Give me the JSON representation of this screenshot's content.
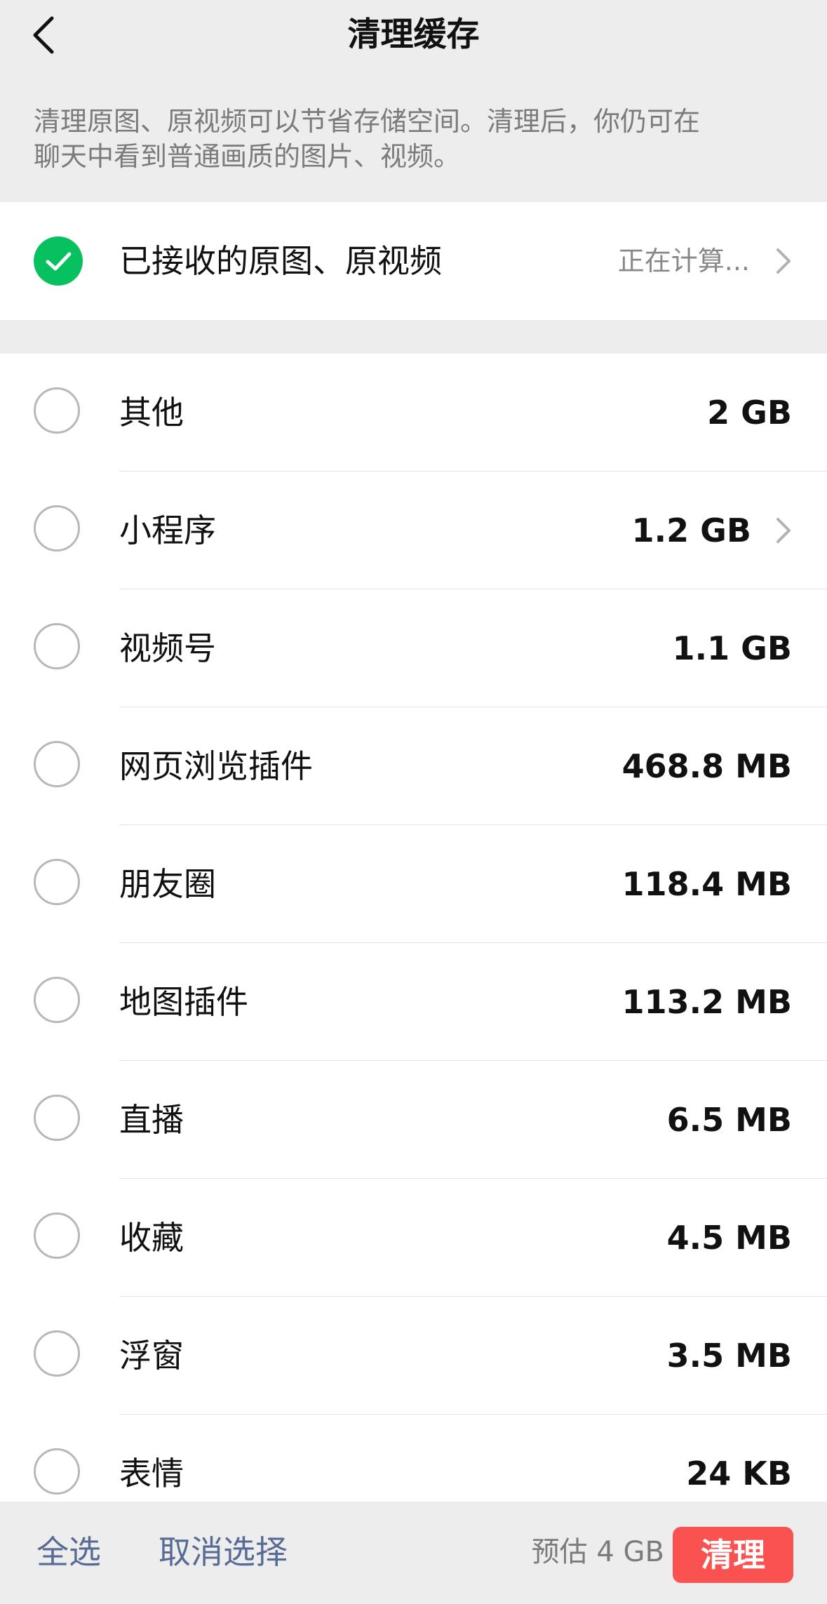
{
  "header": {
    "title": "清理缓存",
    "back_icon": "chevron-left-icon"
  },
  "description": {
    "line1": "清理原图、原视频可以节省存储空间。清理后，你仍可在",
    "line2": "聊天中看到普通画质的图片、视频。"
  },
  "original_media": {
    "label": "已接收的原图、原视频",
    "status": "正在计算...",
    "checked": true,
    "accent_color": "#07c160"
  },
  "items": [
    {
      "label": "其他",
      "size": "2 GB",
      "arrow": false
    },
    {
      "label": "小程序",
      "size": "1.2 GB",
      "arrow": true
    },
    {
      "label": "视频号",
      "size": "1.1 GB",
      "arrow": false
    },
    {
      "label": "网页浏览插件",
      "size": "468.8 MB",
      "arrow": false
    },
    {
      "label": "朋友圈",
      "size": "118.4 MB",
      "arrow": false
    },
    {
      "label": "地图插件",
      "size": "113.2 MB",
      "arrow": false
    },
    {
      "label": "直播",
      "size": "6.5 MB",
      "arrow": false
    },
    {
      "label": "收藏",
      "size": "4.5 MB",
      "arrow": false
    },
    {
      "label": "浮窗",
      "size": "3.5 MB",
      "arrow": false
    },
    {
      "label": "表情",
      "size": "24 KB",
      "arrow": false
    }
  ],
  "bottom_bar": {
    "select_all": "全选",
    "cancel_select": "取消选择",
    "estimate": "预估 4 GB",
    "clean_button": "清理",
    "clean_color": "#fa5151",
    "link_color": "#576b95"
  }
}
